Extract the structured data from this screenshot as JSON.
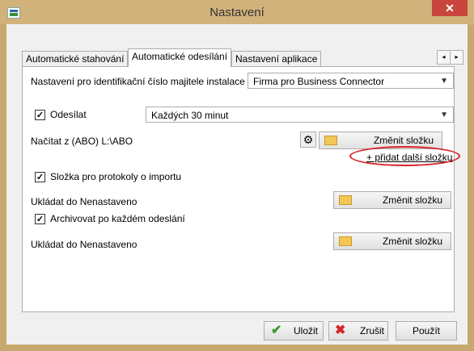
{
  "window": {
    "title": "Nastavení",
    "close_glyph": "✕"
  },
  "tabs": [
    {
      "label": "Automatické stahování",
      "active": false
    },
    {
      "label": "Automatické odesílání",
      "active": true
    },
    {
      "label": "Nastavení aplikace",
      "active": false
    }
  ],
  "tab_scroll": {
    "left": "◂",
    "right": "▸"
  },
  "identification": {
    "label": "Nastavení pro identifikační číslo majitele instalace",
    "value": "Firma pro Business Connector"
  },
  "send": {
    "checkbox_label": "Odesílat",
    "checked": true,
    "interval": "Každých 30 minut"
  },
  "load": {
    "label": "Načítat z (ABO) L:\\ABO",
    "change_folder": "Změnit složku",
    "add_folder_link": "+ přidat další složku"
  },
  "import_protocols": {
    "checkbox_label": "Složka pro protokoly o importu",
    "checked": true,
    "save_label": "Ukládat do Nenastaveno",
    "change_folder": "Změnit složku"
  },
  "archive": {
    "checkbox_label": "Archivovat po každém odeslání",
    "checked": true,
    "save_label": "Ukládat do Nenastaveno",
    "change_folder": "Změnit složku"
  },
  "footer": {
    "save": "Uložit",
    "cancel": "Zrušit",
    "apply": "Použít"
  },
  "colors": {
    "titlebar": "#d2b27b",
    "close": "#c9463d",
    "highlight": "#d8232a"
  },
  "icons": [
    "app-icon",
    "close-icon",
    "gear-icon",
    "folder-icon",
    "check-icon",
    "cross-icon",
    "chevron-down-icon"
  ]
}
